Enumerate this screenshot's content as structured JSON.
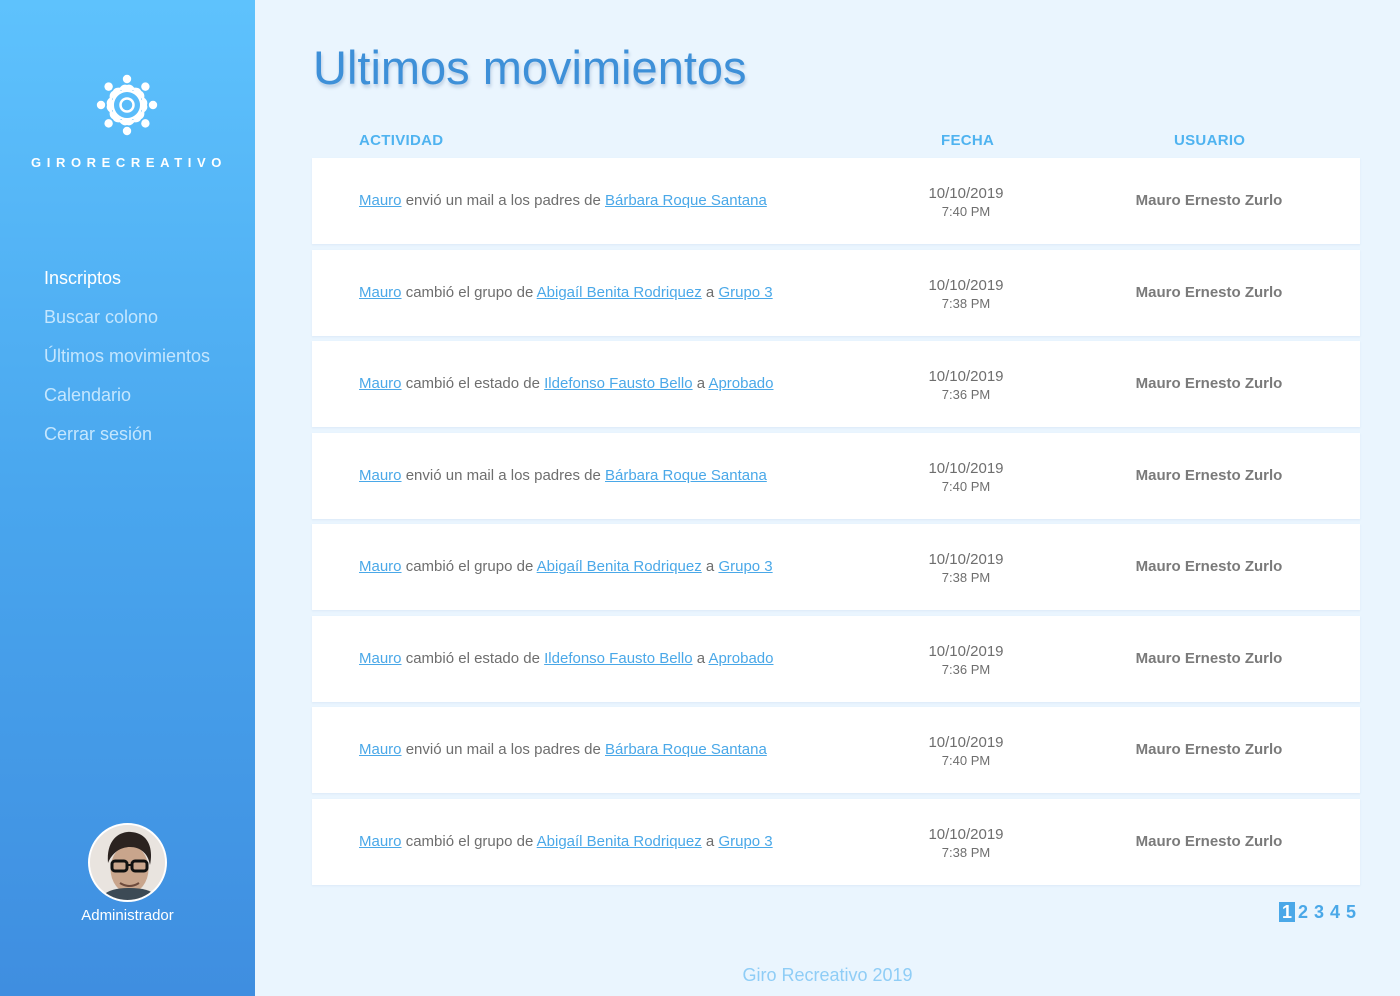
{
  "brand": {
    "name": "GIRORECREATIVO",
    "logo_icon": "flower-people-logo-icon"
  },
  "sidebar": {
    "items": [
      {
        "label": "Inscriptos",
        "active": true
      },
      {
        "label": "Buscar colono",
        "active": false
      },
      {
        "label": "Últimos movimientos",
        "active": false
      },
      {
        "label": "Calendario",
        "active": false
      },
      {
        "label": "Cerrar sesión",
        "active": false
      }
    ],
    "user_role": "Administrador"
  },
  "main": {
    "title": "Ultimos movimientos",
    "columns": {
      "activity": "ACTIVIDAD",
      "date": "FECHA",
      "user": "USUARIO"
    },
    "rows": [
      {
        "actor": "Mauro",
        "text1": "envió un mail a los padres de ",
        "target": "Bárbara Roque Santana",
        "text2": "",
        "value": "",
        "date": "10/10/2019",
        "time": "7:40 PM",
        "user": "Mauro Ernesto Zurlo"
      },
      {
        "actor": "Mauro",
        "text1": "cambió el grupo de",
        "target": "Abigaíl Benita Rodriquez",
        "text2": "a",
        "value": "Grupo 3",
        "date": "10/10/2019",
        "time": "7:38 PM",
        "user": "Mauro Ernesto Zurlo"
      },
      {
        "actor": "Mauro",
        "text1": "cambió el estado de",
        "target": "Ildefonso Fausto Bello",
        "text2": "a",
        "value": "Aprobado",
        "date": "10/10/2019",
        "time": "7:36 PM",
        "user": "Mauro Ernesto Zurlo"
      },
      {
        "actor": "Mauro",
        "text1": "envió un mail a los padres de ",
        "target": "Bárbara Roque Santana",
        "text2": "",
        "value": "",
        "date": "10/10/2019",
        "time": "7:40 PM",
        "user": "Mauro Ernesto Zurlo"
      },
      {
        "actor": "Mauro",
        "text1": "cambió el grupo de",
        "target": "Abigaíl Benita Rodriquez",
        "text2": "a",
        "value": "Grupo 3",
        "date": "10/10/2019",
        "time": "7:38 PM",
        "user": "Mauro Ernesto Zurlo"
      },
      {
        "actor": "Mauro",
        "text1": "cambió el estado de",
        "target": "Ildefonso Fausto Bello",
        "text2": "a",
        "value": "Aprobado",
        "date": "10/10/2019",
        "time": "7:36 PM",
        "user": "Mauro Ernesto Zurlo"
      },
      {
        "actor": "Mauro",
        "text1": "envió un mail a los padres de ",
        "target": "Bárbara Roque Santana",
        "text2": "",
        "value": "",
        "date": "10/10/2019",
        "time": "7:40 PM",
        "user": "Mauro Ernesto Zurlo"
      },
      {
        "actor": "Mauro",
        "text1": "cambió el grupo de",
        "target": "Abigaíl Benita Rodriquez",
        "text2": "a",
        "value": "Grupo 3",
        "date": "10/10/2019",
        "time": "7:38 PM",
        "user": "Mauro Ernesto Zurlo"
      }
    ],
    "pagination": {
      "pages": [
        "1",
        "2",
        "3",
        "4",
        "5"
      ],
      "current": "1"
    }
  },
  "footer": {
    "text": "Giro Recreativo 2019"
  },
  "colors": {
    "accent": "#4aa8e8",
    "title": "#3e90d8",
    "sidebar_top": "#5ec2fd",
    "sidebar_bottom": "#3f8ee0",
    "background": "#eaf5fe"
  }
}
